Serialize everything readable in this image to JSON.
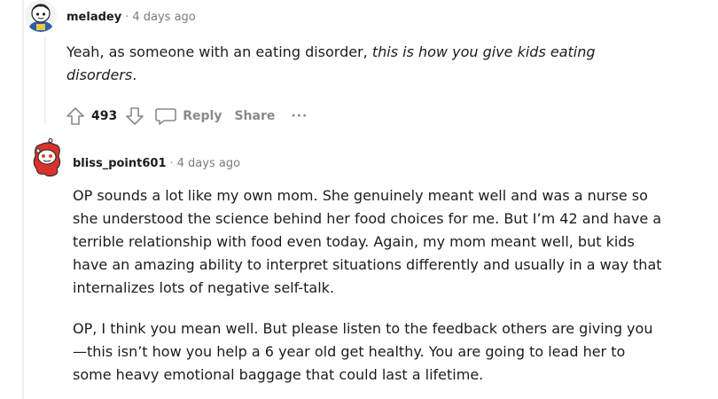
{
  "comment1": {
    "author": "meladey",
    "separator": "·",
    "timestamp": "4 days ago",
    "body_before": "Yeah, as someone with an eating disorder, ",
    "body_italic": "this is how you give kids eating disorders",
    "body_after": ".",
    "score": "493",
    "reply_label": "Reply",
    "share_label": "Share",
    "more_label": "···"
  },
  "comment2": {
    "author": "bliss_point601",
    "separator": "·",
    "timestamp": "4 days ago",
    "paragraph1": "OP sounds a lot like my own mom. She genuinely meant well and was a nurse so she understood the science behind her food choices for me. But I’m 42 and have a terrible relationship with food even today. Again, my mom meant well, but kids have an amazing ability to interpret situations differently and usually in a way that internalizes lots of negative self-talk.",
    "paragraph2": "OP, I think you mean well. But please listen to the feedback others are giving you—this isn’t how you help a 6 year old get healthy. You are going to lead her to some heavy emotional baggage that could last a lifetime."
  }
}
